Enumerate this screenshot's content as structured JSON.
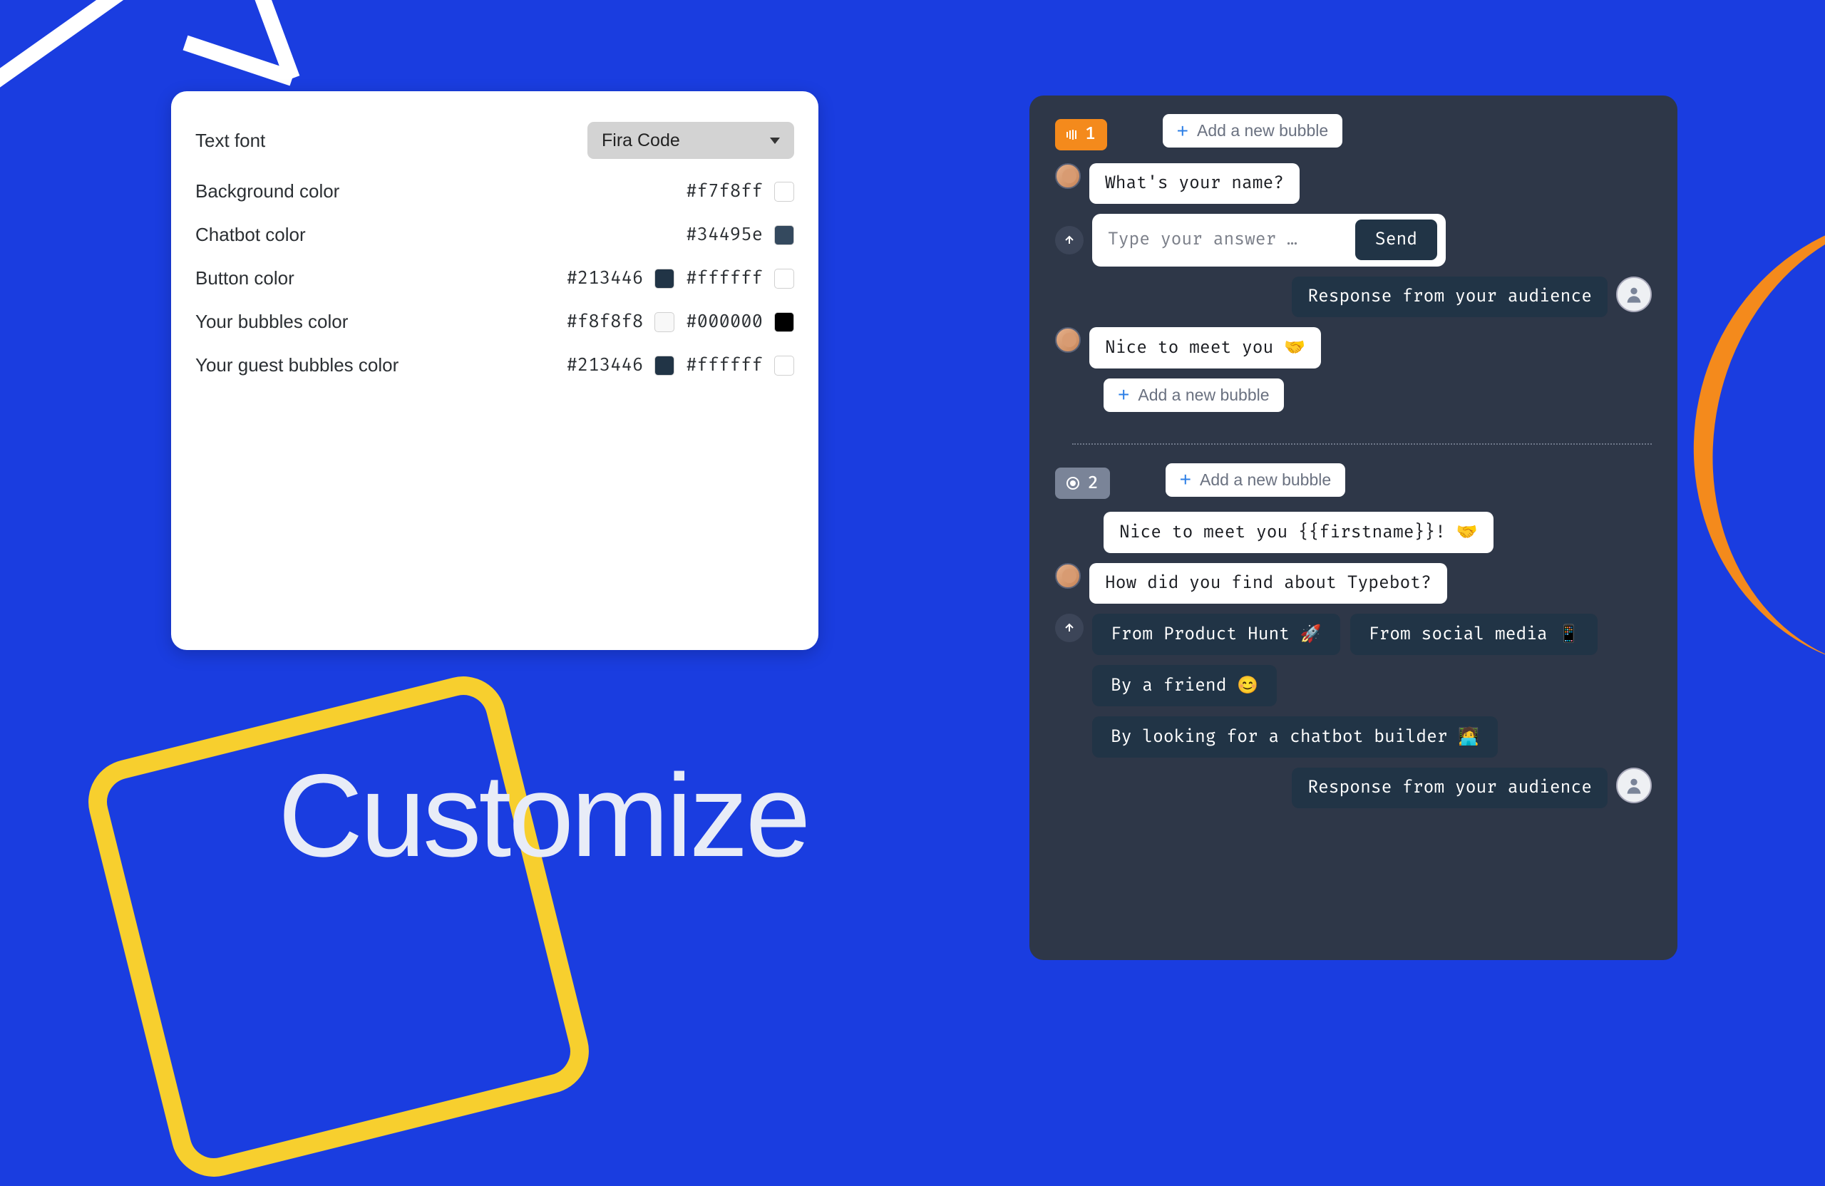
{
  "title": "Customize",
  "panel": {
    "textFont": {
      "label": "Text font",
      "value": "Fira Code"
    },
    "rows": [
      {
        "label": "Background color",
        "values": [
          {
            "hex": "#f7f8ff",
            "c": "#f7f8ff"
          }
        ]
      },
      {
        "label": "Chatbot color",
        "values": [
          {
            "hex": "#34495e",
            "c": "#34495e"
          }
        ]
      },
      {
        "label": "Button color",
        "values": [
          {
            "hex": "#213446",
            "c": "#213446"
          },
          {
            "hex": "#ffffff",
            "c": "#ffffff"
          }
        ]
      },
      {
        "label": "Your bubbles color",
        "values": [
          {
            "hex": "#f8f8f8",
            "c": "#f8f8f8"
          },
          {
            "hex": "#000000",
            "c": "#000000"
          }
        ]
      },
      {
        "label": "Your guest bubbles color",
        "values": [
          {
            "hex": "#213446",
            "c": "#213446"
          },
          {
            "hex": "#ffffff",
            "c": "#ffffff"
          }
        ]
      }
    ]
  },
  "preview": {
    "addBubble": "Add a new bubble",
    "step1": {
      "num": "1",
      "q": "What's your name?",
      "placeholder": "Type your answer …",
      "send": "Send",
      "response": "Response from your audience",
      "nice": "Nice to meet you 🤝"
    },
    "step2": {
      "num": "2",
      "greet": "Nice to meet you {{firstname}}! 🤝",
      "q": "How did you find about Typebot?",
      "choices": [
        "From Product Hunt 🚀",
        "From social media 📱",
        "By a friend 😊",
        "By looking for a chatbot builder 🧑‍💻"
      ],
      "response": "Response from your audience"
    }
  }
}
